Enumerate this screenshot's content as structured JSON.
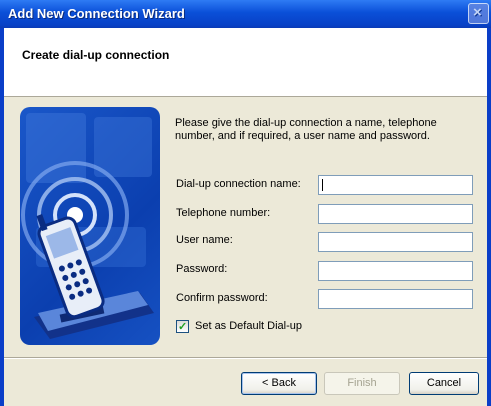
{
  "window": {
    "title": "Add New Connection Wizard"
  },
  "header": {
    "title": "Create dial-up connection"
  },
  "main": {
    "intro": "Please give the dial-up connection a name, telephone number, and if required, a user name and password.",
    "fields": [
      {
        "label": "Dial-up connection name:",
        "value": ""
      },
      {
        "label": "Telephone number:",
        "value": ""
      },
      {
        "label": "User name:",
        "value": ""
      },
      {
        "label": "Password:",
        "value": ""
      },
      {
        "label": "Confirm password:",
        "value": ""
      }
    ],
    "default_checkbox": {
      "label": "Set as Default Dial-up",
      "checked": true
    }
  },
  "buttons": {
    "back": "< Back",
    "finish": "Finish",
    "cancel": "Cancel"
  },
  "colors": {
    "titlebar": "#0A4FD8",
    "face": "#ECE9D8",
    "accent": "#0B3FAF"
  },
  "icons": {
    "close": "close-icon",
    "illustration": "phone-modem-icon"
  }
}
